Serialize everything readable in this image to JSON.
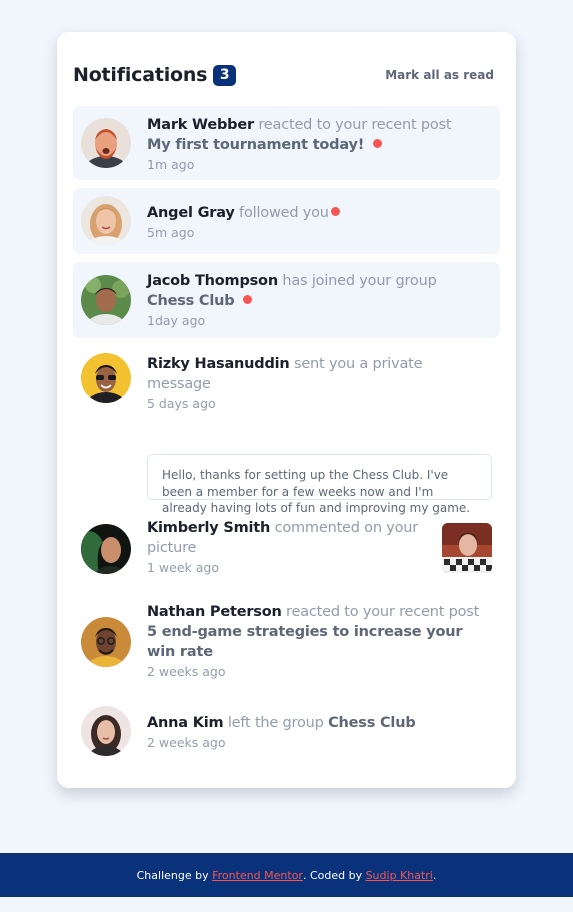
{
  "header": {
    "title": "Notifications",
    "unread_count": "3",
    "mark_all_label": "Mark all as read"
  },
  "notifications": [
    {
      "name": "Mark Webber",
      "action": "reacted to your recent post",
      "target": "My first tournament today!",
      "time": "1m ago",
      "unread": true,
      "avatar_icon": "avatar-mark-webber"
    },
    {
      "name": "Angel Gray",
      "action": "followed you",
      "time": "5m ago",
      "unread": true,
      "avatar_icon": "avatar-angel-gray"
    },
    {
      "name": "Jacob Thompson",
      "action": "has joined your group",
      "target": "Chess Club",
      "time": "1day ago",
      "unread": true,
      "avatar_icon": "avatar-jacob-thompson"
    },
    {
      "name": "Rizky Hasanuddin",
      "action": "sent you a private message",
      "time": "5 days ago",
      "unread": false,
      "message": "Hello, thanks for setting up the Chess Club. I've been a member for a few weeks now and I'm already having lots of fun and improving my game.",
      "avatar_icon": "avatar-rizky-hasanuddin"
    },
    {
      "name": "Kimberly Smith",
      "action": "commented on your picture",
      "time": "1 week ago",
      "unread": false,
      "picture_icon": "chess-picture",
      "avatar_icon": "avatar-kimberly-smith"
    },
    {
      "name": "Nathan Peterson",
      "action": "reacted to your recent post",
      "target": "5 end-game strategies to increase your win rate",
      "time": "2 weeks ago",
      "unread": false,
      "avatar_icon": "avatar-nathan-peterson"
    },
    {
      "name": "Anna Kim",
      "action": "left the group",
      "target": "Chess Club",
      "time": "2 weeks ago",
      "unread": false,
      "avatar_icon": "avatar-anna-kim"
    }
  ],
  "footer": {
    "prefix": "Challenge by",
    "link1": "Frontend Mentor",
    "middle": ". Coded by",
    "link2": "Sudip Khatri",
    "suffix": "."
  },
  "colors": {
    "unread_bg": "#f1f6fd",
    "badge": "#0a327b",
    "dot": "#f65552",
    "footer_bg": "#0a327b"
  }
}
